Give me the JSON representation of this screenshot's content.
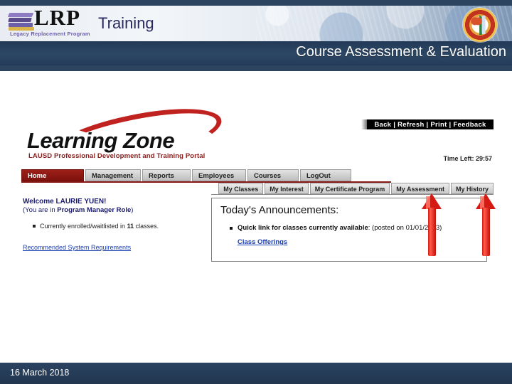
{
  "header": {
    "brand": {
      "name": "LRP",
      "tagline": "Legacy Replacement Program",
      "logo_icon": "stacked-books-icon"
    },
    "training_label": "Training",
    "course_title": "Course Assessment & Evaluation",
    "seal_icon": "lausd-seal-icon",
    "colors": {
      "dark_blue": "#2d4460",
      "band_light": "#e9edf3",
      "title_text": "#ffffff",
      "training_text": "#2a2a5e"
    }
  },
  "screenshot": {
    "portal": {
      "logo_text": "Learning Zone",
      "logo_tagline": "LAUSD Professional Development and Training Portal",
      "swoosh_color": "#c0231f"
    },
    "browser_toolbar": {
      "items_label": "Back | Refresh | Print | Feedback",
      "items": [
        "Back",
        "Refresh",
        "Print",
        "Feedback"
      ]
    },
    "time_left": "Time Left: 29:57",
    "primary_nav": [
      {
        "label": "Home",
        "active": true
      },
      {
        "label": "Management",
        "active": false
      },
      {
        "label": "Reports",
        "active": false
      },
      {
        "label": "Employees",
        "active": false
      },
      {
        "label": "Courses",
        "active": false
      },
      {
        "label": "LogOut",
        "active": false
      }
    ],
    "secondary_nav": [
      {
        "label": "My Classes"
      },
      {
        "label": "My Interest"
      },
      {
        "label": "My Certificate Program"
      },
      {
        "label": "My Assessment"
      },
      {
        "label": "My History"
      }
    ],
    "welcome": {
      "greeting": "Welcome LAURIE YUEN!",
      "role_prefix": "(You are in ",
      "role_name": "Program Manager Role",
      "role_suffix": ")",
      "enrollment_prefix": "Currently enrolled/waitlisted in ",
      "enrollment_count": "11",
      "enrollment_suffix": " classes.",
      "system_requirements_link": "Recommended System Requirements"
    },
    "announcements": {
      "title": "Today's Announcements:",
      "item_prefix": "Quick link for ",
      "item_bold": "classes currently available",
      "item_suffix": ": (posted on 01/01/2013)",
      "link": "Class Offerings"
    },
    "annotations": {
      "arrow_color": "#d41a12",
      "arrow_targets": [
        "My Assessment",
        "My History"
      ]
    }
  },
  "footer": {
    "date": "16 March 2018"
  }
}
